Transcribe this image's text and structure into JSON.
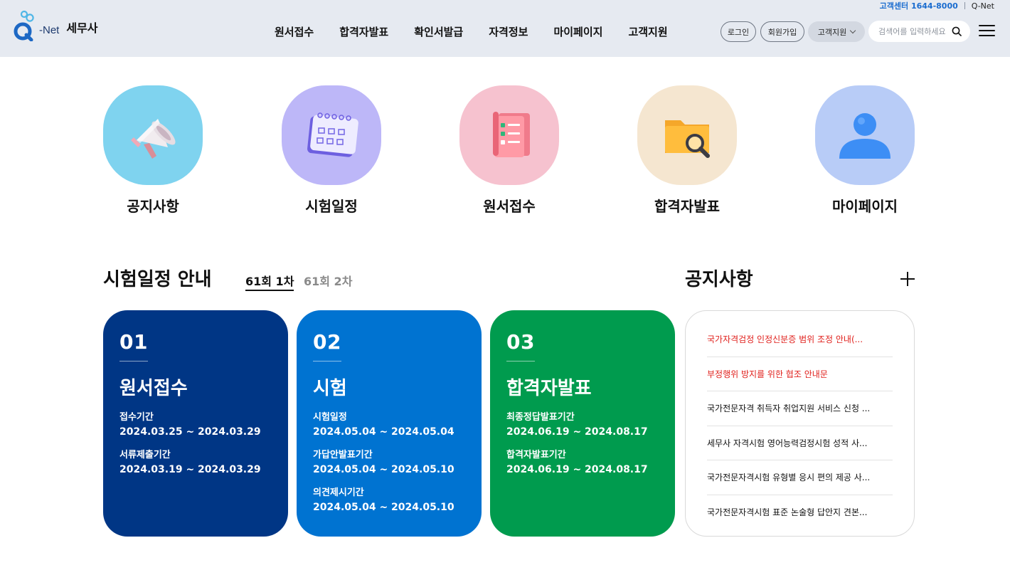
{
  "colors": {
    "header_bg": "#e6eaf1",
    "card1": "#003685",
    "card2": "#0073d1",
    "card3": "#009b4e",
    "notice_red": "#e0201c"
  },
  "top_util": {
    "customer_center": "고객센터 1644-8000",
    "qnet": "Q-Net"
  },
  "header": {
    "brand": "-Net",
    "site_name": "세무사",
    "nav": [
      "원서접수",
      "합격자발표",
      "확인서발급",
      "자격정보",
      "마이페이지",
      "고객지원"
    ],
    "login": "로그인",
    "join": "회원가입",
    "support": "고객지원",
    "search_placeholder": "검색어를 입력하세요"
  },
  "quick_links": [
    {
      "label": "공지사항",
      "icon": "megaphone-icon",
      "bg": "#7fd3ef"
    },
    {
      "label": "시험일정",
      "icon": "calendar-icon",
      "bg": "#bdb7f8"
    },
    {
      "label": "원서접수",
      "icon": "checklist-document-icon",
      "bg": "#f6c2cf"
    },
    {
      "label": "합격자발표",
      "icon": "folder-search-icon",
      "bg": "#f5e6d0"
    },
    {
      "label": "마이페이지",
      "icon": "user-icon",
      "bg": "#b8ccf7"
    }
  ],
  "schedule": {
    "title": "시험일정 안내",
    "tabs": [
      "61회 1차",
      "61회 2차"
    ],
    "active_tab": "61회 1차",
    "cards": [
      {
        "num": "01",
        "title": "원서접수",
        "items": [
          {
            "label": "접수기간",
            "value": "2024.03.25 ~ 2024.03.29"
          },
          {
            "label": "서류제출기간",
            "value": "2024.03.19 ~ 2024.03.29"
          }
        ]
      },
      {
        "num": "02",
        "title": "시험",
        "items": [
          {
            "label": "시험일정",
            "value": "2024.05.04 ~ 2024.05.04"
          },
          {
            "label": "가답안발표기간",
            "value": "2024.05.04 ~ 2024.05.10"
          },
          {
            "label": "의견제시기간",
            "value": "2024.05.04 ~ 2024.05.10"
          }
        ]
      },
      {
        "num": "03",
        "title": "합격자발표",
        "items": [
          {
            "label": "최종정답발표기간",
            "value": "2024.06.19 ~ 2024.08.17"
          },
          {
            "label": "합격자발표기간",
            "value": "2024.06.19 ~ 2024.08.17"
          }
        ]
      }
    ]
  },
  "notices": {
    "title": "공지사항",
    "items": [
      {
        "text": "국가자격검정 인정신분증 범위 조정 안내(...",
        "highlight": true
      },
      {
        "text": "부정행위 방지를 위한 협조 안내문",
        "highlight": true
      },
      {
        "text": "국가전문자격 취득자 취업지원 서비스 신청 ...",
        "highlight": false
      },
      {
        "text": "세무사 자격시험 영어능력검정시험 성적 사...",
        "highlight": false
      },
      {
        "text": "국가전문자격시험 유형별 응시 편의 제공 사...",
        "highlight": false
      },
      {
        "text": "국가전문자격시험 표준 논술형 답안지 견본...",
        "highlight": false
      }
    ]
  }
}
